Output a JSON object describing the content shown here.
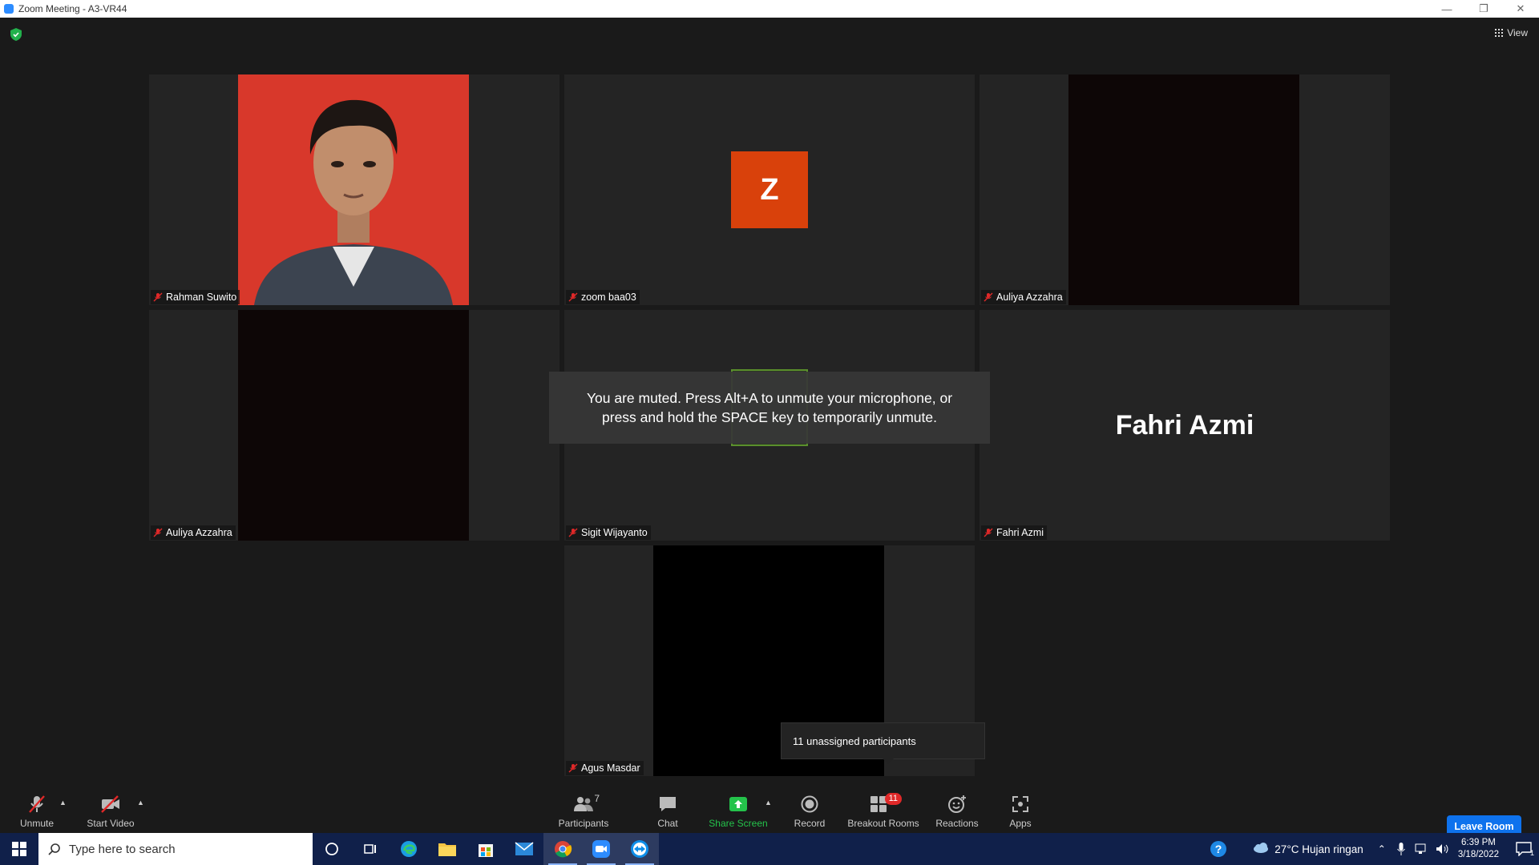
{
  "window": {
    "title": "Zoom Meeting - A3-VR44"
  },
  "header": {
    "view_label": "View"
  },
  "tiles": [
    {
      "name": "Rahman Suwito"
    },
    {
      "name": "zoom baa03",
      "avatar_letter": "Z"
    },
    {
      "name": "Auliya Azzahra"
    },
    {
      "name": "Auliya Azzahra"
    },
    {
      "name": "Sigit Wijayanto"
    },
    {
      "name": "Fahri Azmi",
      "display_name": "Fahri Azmi"
    },
    {
      "name": "Agus Masdar"
    }
  ],
  "toast": {
    "line1": "You are muted. Press Alt+A to unmute your microphone, or",
    "line2": "press and hold the SPACE key to temporarily unmute."
  },
  "popover": {
    "text": "11 unassigned participants"
  },
  "toolbar": {
    "unmute": "Unmute",
    "start_video": "Start Video",
    "participants": "Participants",
    "participants_count": "7",
    "chat": "Chat",
    "share_screen": "Share Screen",
    "record": "Record",
    "breakout_rooms": "Breakout Rooms",
    "breakout_badge": "11",
    "reactions": "Reactions",
    "apps": "Apps",
    "leave_room": "Leave Room"
  },
  "taskbar": {
    "search_placeholder": "Type here to search",
    "weather": "27°C  Hujan ringan",
    "time": "6:39 PM",
    "date": "3/18/2022",
    "notification_count": "1"
  },
  "colors": {
    "zoom_blue": "#0e72ed",
    "share_green": "#24c34b",
    "avatar_orange": "#d9410b",
    "badge_red": "#e02828"
  }
}
